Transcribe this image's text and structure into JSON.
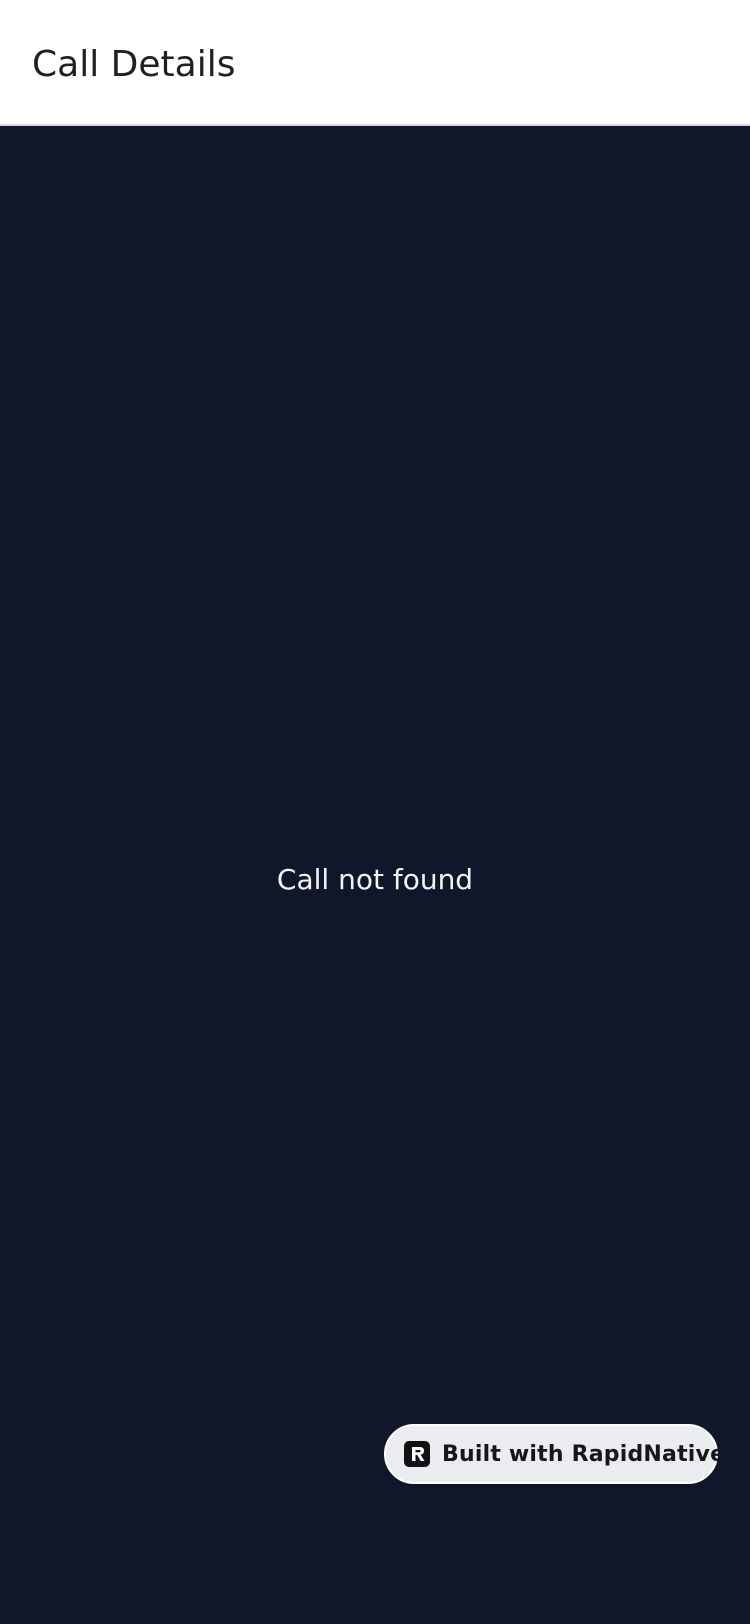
{
  "header": {
    "title": "Call Details"
  },
  "main": {
    "empty_message": "Call not found"
  },
  "badge": {
    "label": "Built with RapidNative",
    "icon": "rapidnative-logo-icon"
  },
  "colors": {
    "header_background": "#ffffff",
    "content_background": "#10172a",
    "badge_background": "#ebecef",
    "title_text": "#1f1f24",
    "message_text": "#f5f6f8"
  }
}
